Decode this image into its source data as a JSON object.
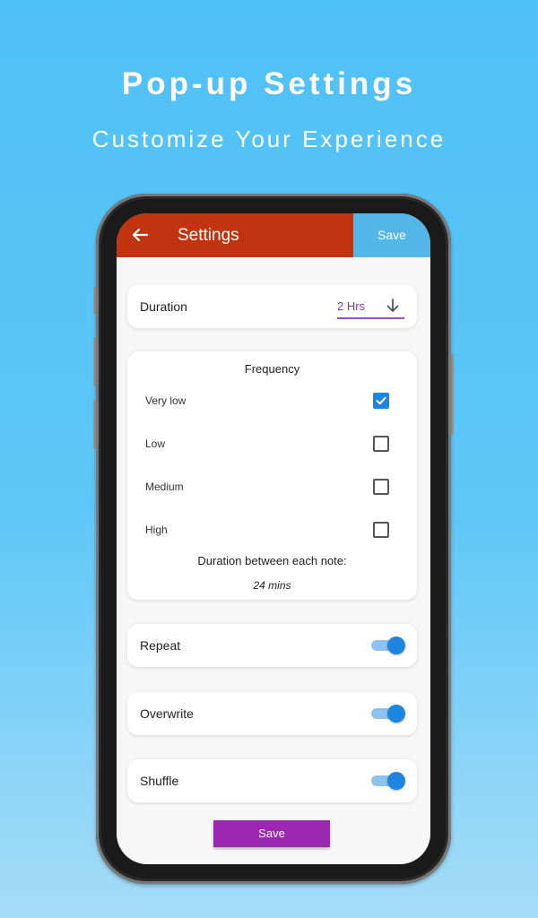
{
  "promo": {
    "title": "Pop-up Settings",
    "subtitle": "Customize Your Experience"
  },
  "app_bar": {
    "title": "Settings",
    "save_label": "Save",
    "back_icon": "arrow-left-icon",
    "color": "#c23410",
    "save_color": "#52b6e8"
  },
  "duration": {
    "label": "Duration",
    "value": "2 Hrs",
    "dropdown_icon": "arrow-down-icon",
    "accent": "#7a3bb0"
  },
  "frequency": {
    "title": "Frequency",
    "options": [
      {
        "label": "Very low",
        "checked": true
      },
      {
        "label": "Low",
        "checked": false
      },
      {
        "label": "Medium",
        "checked": false
      },
      {
        "label": "High",
        "checked": false
      }
    ],
    "between_label": "Duration between each note:",
    "between_value": "24 mins"
  },
  "toggles": {
    "repeat": {
      "label": "Repeat",
      "on": true
    },
    "overwrite": {
      "label": "Overwrite",
      "on": true
    },
    "shuffle": {
      "label": "Shuffle",
      "on": true
    }
  },
  "footer": {
    "save_label": "Save",
    "color": "#9c27b0"
  }
}
